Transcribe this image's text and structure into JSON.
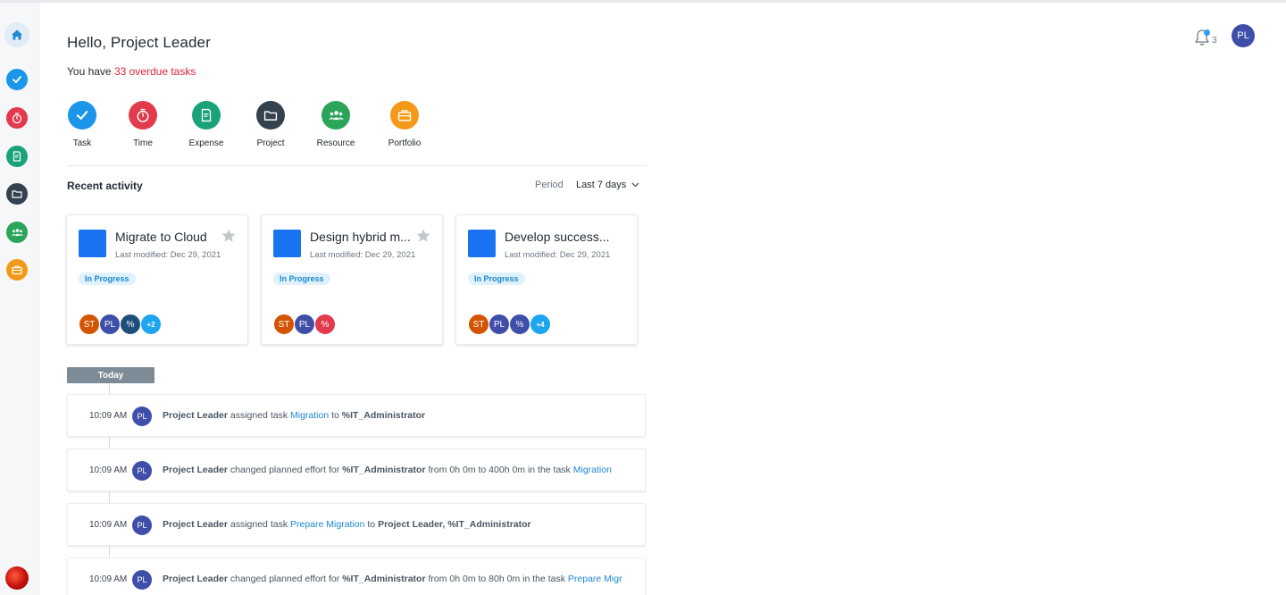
{
  "sidebar": {
    "items": [
      {
        "name": "home",
        "icon": "home-icon",
        "color": "#1e88d5"
      },
      {
        "name": "task",
        "icon": "check-icon",
        "color": "#1b96e8"
      },
      {
        "name": "time",
        "icon": "timer-icon",
        "color": "#e23b4e"
      },
      {
        "name": "expense",
        "icon": "receipt-icon",
        "color": "#1aa37a"
      },
      {
        "name": "project",
        "icon": "folder-icon",
        "color": "#34414e"
      },
      {
        "name": "resource",
        "icon": "people-icon",
        "color": "#2aa55a"
      },
      {
        "name": "portfolio",
        "icon": "briefcase-icon",
        "color": "#f39a1a"
      }
    ]
  },
  "header": {
    "greeting": "Hello, Project Leader",
    "overdue_prefix": "You have ",
    "overdue_link": "33 overdue tasks",
    "notifications_count": "3",
    "user_initials": "PL"
  },
  "quick_actions": [
    {
      "label": "Task",
      "icon": "check-icon",
      "color": "#1b96e8"
    },
    {
      "label": "Time",
      "icon": "timer-icon",
      "color": "#e23b4e"
    },
    {
      "label": "Expense",
      "icon": "receipt-icon",
      "color": "#1aa37a"
    },
    {
      "label": "Project",
      "icon": "folder-icon",
      "color": "#34414e"
    },
    {
      "label": "Resource",
      "icon": "people-icon",
      "color": "#2aa55a"
    },
    {
      "label": "Portfolio",
      "icon": "briefcase-icon",
      "color": "#f39a1a"
    }
  ],
  "recent": {
    "title": "Recent activity",
    "period_label": "Period",
    "period_value": "Last 7 days"
  },
  "cards": [
    {
      "title": "Migrate to Cloud",
      "modified": "Last modified: Dec 29, 2021",
      "status": "In Progress",
      "avatars": [
        {
          "t": "ST",
          "c": "#d35400"
        },
        {
          "t": "PL",
          "c": "#3f4fa9"
        },
        {
          "t": "%",
          "c": "#1d4f7a"
        },
        {
          "t": "+2",
          "c": "#1ea5f0"
        }
      ]
    },
    {
      "title": "Design hybrid m...",
      "modified": "Last modified: Dec 29, 2021",
      "status": "In Progress",
      "avatars": [
        {
          "t": "ST",
          "c": "#d35400"
        },
        {
          "t": "PL",
          "c": "#3f4fa9"
        },
        {
          "t": "%",
          "c": "#e23b4e"
        }
      ]
    },
    {
      "title": "Develop success...",
      "modified": "Last modified: Dec 29, 2021",
      "status": "In Progress",
      "avatars": [
        {
          "t": "ST",
          "c": "#d35400"
        },
        {
          "t": "PL",
          "c": "#3f4fa9"
        },
        {
          "t": "%",
          "c": "#3f4fa9"
        },
        {
          "t": "+4",
          "c": "#1ea5f0"
        }
      ]
    }
  ],
  "timeline": {
    "today_label": "Today",
    "activities": [
      {
        "time": "10:09 AM",
        "initials": "PL",
        "parts": [
          [
            "b",
            "Project Leader"
          ],
          [
            "t",
            " assigned task "
          ],
          [
            "l",
            "Migration"
          ],
          [
            "t",
            " to "
          ],
          [
            "b",
            "%IT_Administrator"
          ]
        ]
      },
      {
        "time": "10:09 AM",
        "initials": "PL",
        "parts": [
          [
            "b",
            "Project Leader"
          ],
          [
            "t",
            " changed planned effort for "
          ],
          [
            "b",
            "%IT_Administrator"
          ],
          [
            "t",
            " from 0h 0m to 400h 0m in the task "
          ],
          [
            "l",
            "Migration"
          ]
        ]
      },
      {
        "time": "10:09 AM",
        "initials": "PL",
        "parts": [
          [
            "b",
            "Project Leader"
          ],
          [
            "t",
            " assigned task "
          ],
          [
            "l",
            "Prepare Migration"
          ],
          [
            "t",
            " to "
          ],
          [
            "b",
            "Project Leader, %IT_Administrator"
          ]
        ]
      },
      {
        "time": "10:09 AM",
        "initials": "PL",
        "parts": [
          [
            "b",
            "Project Leader"
          ],
          [
            "t",
            " changed planned effort for "
          ],
          [
            "b",
            "%IT_Administrator"
          ],
          [
            "t",
            " from 0h 0m to 80h 0m in the task "
          ],
          [
            "l",
            "Prepare Migr"
          ]
        ]
      }
    ]
  }
}
